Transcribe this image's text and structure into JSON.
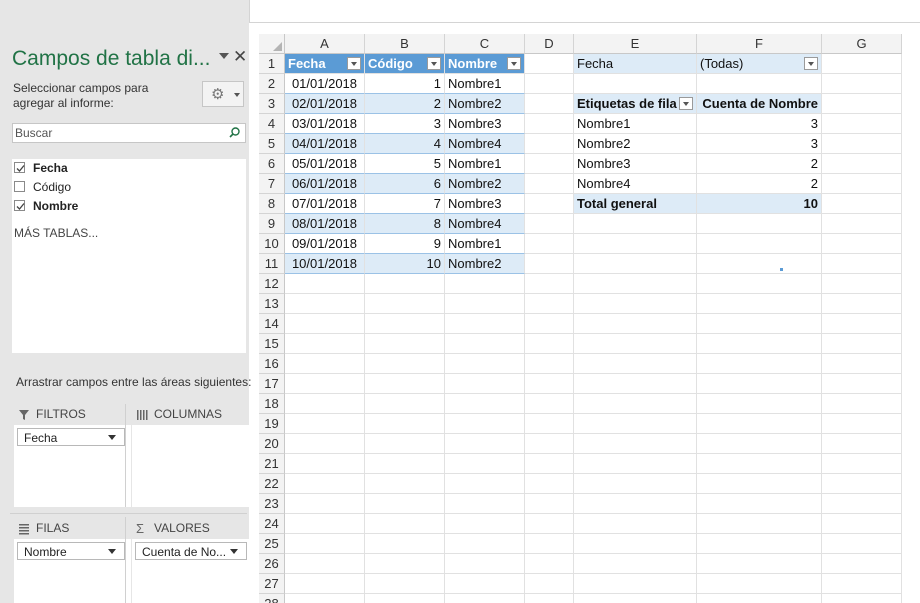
{
  "pane": {
    "title": "Campos de tabla di...",
    "close_glyph": "✕",
    "instructions": "Seleccionar campos para agregar al informe:",
    "gear_icon": "gear-icon",
    "search_placeholder": "Buscar",
    "fields": [
      {
        "label": "Fecha",
        "checked": true
      },
      {
        "label": "Código",
        "checked": false
      },
      {
        "label": "Nombre",
        "checked": true
      }
    ],
    "more_tables": "MÁS TABLAS...",
    "drag_hint": "Arrastrar campos entre las áreas siguientes:",
    "areas": {
      "filters": {
        "label": "FILTROS",
        "items": [
          "Fecha"
        ]
      },
      "columns": {
        "label": "COLUMNAS",
        "items": []
      },
      "rows": {
        "label": "FILAS",
        "items": [
          "Nombre"
        ]
      },
      "values": {
        "label": "VALORES",
        "items": [
          "Cuenta de No..."
        ]
      }
    }
  },
  "sheet": {
    "columns": [
      "A",
      "B",
      "C",
      "D",
      "E",
      "F",
      "G"
    ],
    "rows": [
      "1",
      "2",
      "3",
      "4",
      "5",
      "6",
      "7",
      "8",
      "9",
      "10",
      "11",
      "12",
      "13",
      "14",
      "15",
      "16",
      "17",
      "18",
      "19",
      "20",
      "21",
      "22",
      "23",
      "24",
      "25",
      "26",
      "27",
      "28"
    ],
    "table": {
      "headers": [
        "Fecha",
        "Código",
        "Nombre"
      ],
      "data": [
        [
          "01/01/2018",
          "1",
          "Nombre1"
        ],
        [
          "02/01/2018",
          "2",
          "Nombre2"
        ],
        [
          "03/01/2018",
          "3",
          "Nombre3"
        ],
        [
          "04/01/2018",
          "4",
          "Nombre4"
        ],
        [
          "05/01/2018",
          "5",
          "Nombre1"
        ],
        [
          "06/01/2018",
          "6",
          "Nombre2"
        ],
        [
          "07/01/2018",
          "7",
          "Nombre3"
        ],
        [
          "08/01/2018",
          "8",
          "Nombre4"
        ],
        [
          "09/01/2018",
          "9",
          "Nombre1"
        ],
        [
          "10/01/2018",
          "10",
          "Nombre2"
        ]
      ]
    },
    "pivot": {
      "filter_label": "Fecha",
      "filter_value": "(Todas)",
      "row_labels_header": "Etiquetas de fila",
      "value_header": "Cuenta de Nombre",
      "rows": [
        [
          "Nombre1",
          "3"
        ],
        [
          "Nombre2",
          "3"
        ],
        [
          "Nombre3",
          "2"
        ],
        [
          "Nombre4",
          "2"
        ]
      ],
      "total_label": "Total general",
      "total_value": "10"
    }
  },
  "colors": {
    "accent_green": "#217346",
    "table_header": "#5b9bd5",
    "table_band": "#ddebf7"
  }
}
